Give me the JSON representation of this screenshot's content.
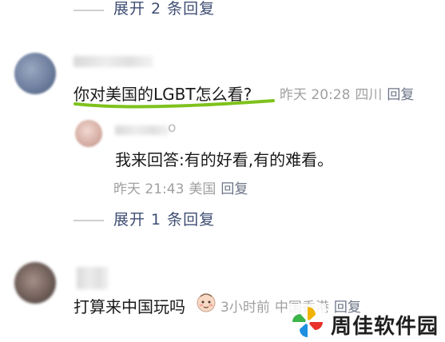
{
  "expand_top": {
    "label": "展开 2 条回复"
  },
  "comment_main": {
    "text": "你对美国的LGBT怎么看?",
    "time": "昨天 20:28",
    "location": "四川",
    "reply_label": "回复"
  },
  "reply": {
    "name_hint": "o",
    "text": "我来回答:有的好看,有的难看。",
    "time": "昨天 21:43",
    "location": "美国",
    "reply_label": "回复"
  },
  "expand_mid": {
    "label": "展开 1 条回复"
  },
  "comment_bottom": {
    "text": "打算来中国玩吗",
    "time": "3小时前",
    "location": "中国香港",
    "reply_label": "回复"
  },
  "watermark": {
    "text": "周佳软件园"
  },
  "colors": {
    "annotation_green": "#7ec21c",
    "expand_link": "#3e4d73",
    "meta_gray": "#a0a0a0"
  },
  "icons": {
    "emoji": "shy-face-emoji-icon",
    "watermark_logo": "pinwheel-logo-icon"
  }
}
